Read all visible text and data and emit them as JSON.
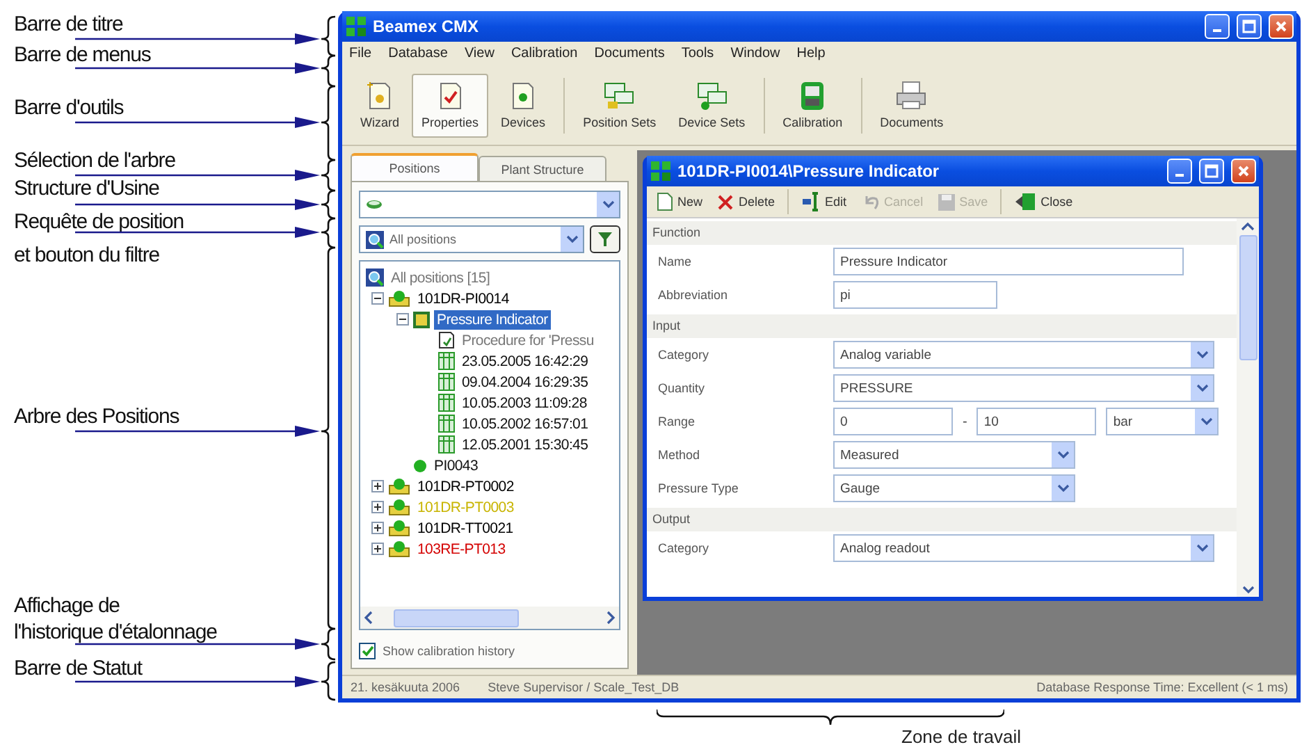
{
  "annotations": [
    {
      "label": "Barre de titre"
    },
    {
      "label": "Barre de menus"
    },
    {
      "label": "Barre d'outils"
    },
    {
      "label": "Sélection de l'arbre"
    },
    {
      "label": "Structure d'Usine"
    },
    {
      "label": "Requête de position\net bouton du filtre"
    },
    {
      "label": "Arbre des Positions"
    },
    {
      "label": "Affichage de\nl'historique d'étalonnage"
    },
    {
      "label": "Barre de Statut"
    }
  ],
  "work_area_label": "Zone de travail",
  "window": {
    "title": "Beamex CMX"
  },
  "menu": [
    "File",
    "Database",
    "View",
    "Calibration",
    "Documents",
    "Tools",
    "Window",
    "Help"
  ],
  "toolbar": [
    {
      "label": "Wizard",
      "kind": "wizard",
      "selected": false
    },
    {
      "label": "Properties",
      "kind": "properties",
      "selected": true
    },
    {
      "label": "Devices",
      "kind": "devices",
      "selected": false,
      "separator_after": true
    },
    {
      "label": "Position Sets",
      "kind": "position-sets",
      "selected": false
    },
    {
      "label": "Device Sets",
      "kind": "device-sets",
      "selected": false,
      "separator_after": true
    },
    {
      "label": "Calibration",
      "kind": "calibration",
      "selected": false,
      "separator_after": true
    },
    {
      "label": "Documents",
      "kind": "documents",
      "selected": false
    }
  ],
  "tabs": [
    {
      "label": "Positions",
      "selected": true
    },
    {
      "label": "Plant Structure",
      "selected": false
    }
  ],
  "query": {
    "value": "All positions"
  },
  "tree": [
    {
      "label": "All positions [15]",
      "kind": "query",
      "selected": false,
      "children": [
        {
          "label": "101DR-PI0014",
          "kind": "position",
          "color": "#000000",
          "selected": false,
          "expanded": true,
          "children": [
            {
              "label": "Pressure Indicator",
              "kind": "function",
              "selected": true,
              "expanded": true,
              "children": [
                {
                  "label": "Procedure for 'Pressu",
                  "kind": "procedure",
                  "selected": false
                },
                {
                  "label": "23.05.2005 16:42:29",
                  "kind": "result",
                  "selected": false
                },
                {
                  "label": "09.04.2004 16:29:35",
                  "kind": "result",
                  "selected": false
                },
                {
                  "label": "10.05.2003 11:09:28",
                  "kind": "result",
                  "selected": false
                },
                {
                  "label": "10.05.2002 16:57:01",
                  "kind": "result",
                  "selected": false
                },
                {
                  "label": "12.05.2001 15:30:45",
                  "kind": "result",
                  "selected": false
                }
              ]
            },
            {
              "label": "PI0043",
              "kind": "device",
              "selected": false
            }
          ]
        },
        {
          "label": "101DR-PT0002",
          "kind": "position",
          "color": "#000000",
          "selected": false,
          "expanded": false
        },
        {
          "label": "101DR-PT0003",
          "kind": "position",
          "color": "#c8b400",
          "selected": false,
          "expanded": false
        },
        {
          "label": "101DR-TT0021",
          "kind": "position",
          "color": "#000000",
          "selected": false,
          "expanded": false
        },
        {
          "label": "103RE-PT013",
          "kind": "position",
          "color": "#d40000",
          "selected": false,
          "expanded": false
        }
      ]
    }
  ],
  "show_history": {
    "label": "Show calibration history",
    "checked": true
  },
  "child": {
    "title": "101DR-PI0014\\Pressure Indicator",
    "toolbar": [
      {
        "label": "New",
        "kind": "new",
        "disabled": false
      },
      {
        "label": "Delete",
        "kind": "delete",
        "disabled": false,
        "separator_after": true
      },
      {
        "label": "Edit",
        "kind": "edit",
        "disabled": false
      },
      {
        "label": "Cancel",
        "kind": "cancel",
        "disabled": true
      },
      {
        "label": "Save",
        "kind": "save",
        "disabled": true,
        "separator_after": true
      },
      {
        "label": "Close",
        "kind": "close",
        "disabled": false
      }
    ],
    "sections": [
      {
        "title": "Function",
        "fields": [
          {
            "kind": "text",
            "label": "Name",
            "value": "Pressure Indicator"
          },
          {
            "kind": "short-text",
            "label": "Abbreviation",
            "value": "pi"
          }
        ]
      },
      {
        "title": "Input",
        "fields": [
          {
            "kind": "select",
            "label": "Category",
            "value": "Analog variable"
          },
          {
            "kind": "select",
            "label": "Quantity",
            "value": "PRESSURE"
          },
          {
            "kind": "range",
            "label": "Range",
            "from": "0",
            "separator": "-",
            "to": "10",
            "unit": "bar"
          },
          {
            "kind": "short-select",
            "label": "Method",
            "value": "Measured"
          },
          {
            "kind": "short-select",
            "label": "Pressure Type",
            "value": "Gauge"
          }
        ]
      },
      {
        "title": "Output",
        "fields": [
          {
            "kind": "select",
            "label": "Category",
            "value": "Analog readout"
          }
        ]
      }
    ]
  },
  "status_bar": {
    "date": "21. kesäkuuta 2006",
    "user": "Steve Supervisor / Scale_Test_DB",
    "response": "Database Response Time: Excellent (< 1 ms)"
  }
}
